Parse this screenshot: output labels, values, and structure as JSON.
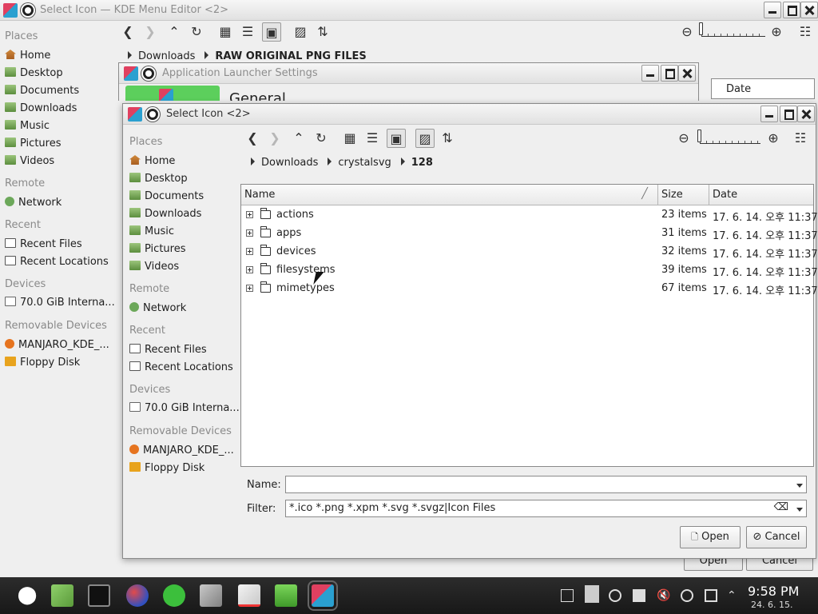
{
  "bg_window": {
    "title": "Select Icon — KDE Menu Editor <2>",
    "places": {
      "header_places": "Places",
      "items_places": [
        "Home",
        "Desktop",
        "Documents",
        "Downloads",
        "Music",
        "Pictures",
        "Videos"
      ],
      "header_remote": "Remote",
      "items_remote": [
        "Network"
      ],
      "header_recent": "Recent",
      "items_recent": [
        "Recent Files",
        "Recent Locations"
      ],
      "header_devices": "Devices",
      "items_devices": [
        "70.0 GiB Interna..."
      ],
      "header_removable": "Removable Devices",
      "items_removable": [
        "MANJARO_KDE_...",
        "Floppy Disk"
      ]
    },
    "breadcrumb": [
      "Downloads",
      "RAW ORIGINAL PNG FILES"
    ],
    "date_header": "Date",
    "open_label": "Open",
    "cancel_label": "Cancel"
  },
  "mid_window": {
    "title": "Application Launcher Settings",
    "section": "General"
  },
  "dialog": {
    "title": "Select Icon <2>",
    "places": {
      "header_places": "Places",
      "items_places": [
        "Home",
        "Desktop",
        "Documents",
        "Downloads",
        "Music",
        "Pictures",
        "Videos"
      ],
      "header_remote": "Remote",
      "items_remote": [
        "Network"
      ],
      "header_recent": "Recent",
      "items_recent": [
        "Recent Files",
        "Recent Locations"
      ],
      "header_devices": "Devices",
      "items_devices": [
        "70.0 GiB Interna..."
      ],
      "header_removable": "Removable Devices",
      "items_removable": [
        "MANJARO_KDE_...",
        "Floppy Disk"
      ]
    },
    "breadcrumb": [
      "Downloads",
      "crystalsvg",
      "128"
    ],
    "columns": {
      "name": "Name",
      "size": "Size",
      "date": "Date"
    },
    "files": [
      {
        "name": "actions",
        "size": "23 items",
        "date": "17. 6. 14. 오후 11:37"
      },
      {
        "name": "apps",
        "size": "31 items",
        "date": "17. 6. 14. 오후 11:37"
      },
      {
        "name": "devices",
        "size": "32 items",
        "date": "17. 6. 14. 오후 11:37"
      },
      {
        "name": "filesystems",
        "size": "39 items",
        "date": "17. 6. 14. 오후 11:37"
      },
      {
        "name": "mimetypes",
        "size": "67 items",
        "date": "17. 6. 14. 오후 11:37"
      }
    ],
    "name_label": "Name:",
    "name_value": "",
    "filter_label": "Filter:",
    "filter_value": "*.ico *.png *.xpm *.svg *.svgz|Icon Files",
    "open_label": "Open",
    "cancel_label": "Cancel"
  },
  "taskbar": {
    "time": "9:58 PM",
    "date": "24. 6. 15."
  }
}
